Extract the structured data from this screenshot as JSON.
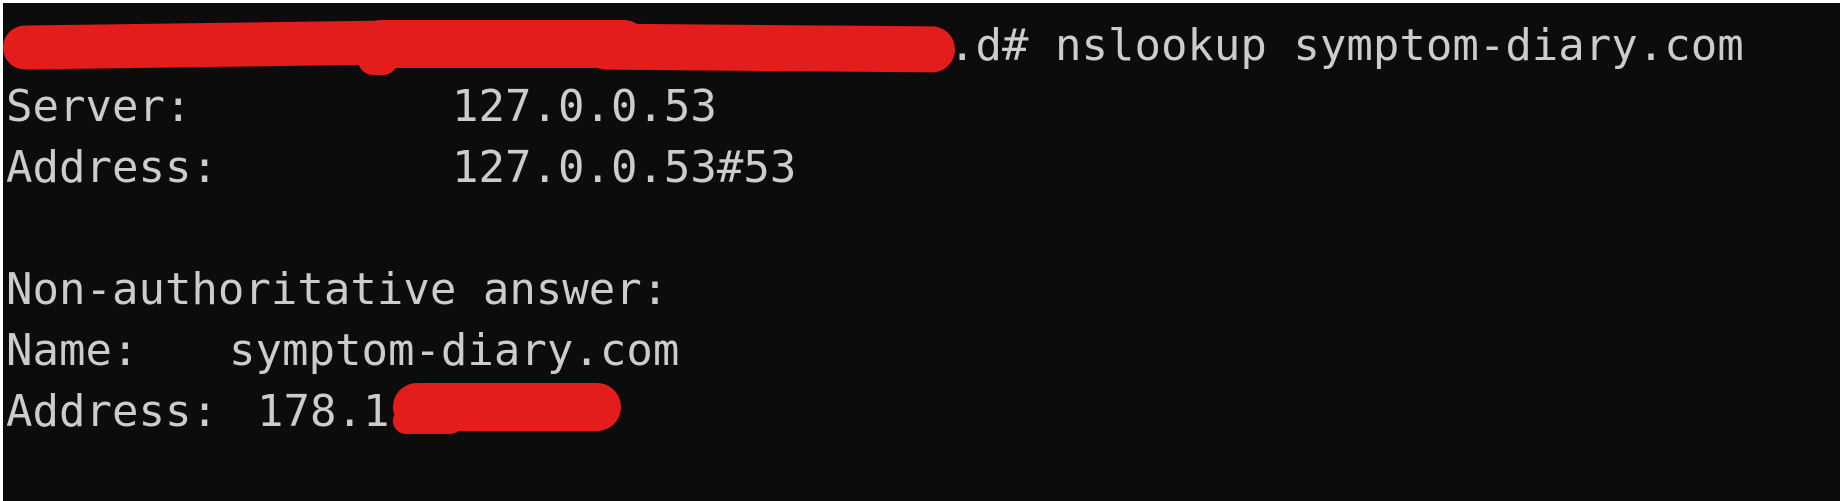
{
  "terminal": {
    "prompt": {
      "suffix": ".d#",
      "command": "nslookup symptom-diary.com"
    },
    "server": {
      "label": "Server:",
      "value": "127.0.0.53"
    },
    "server_address": {
      "label": "Address:",
      "value": "127.0.0.53#53"
    },
    "answer_header": "Non-authoritative answer:",
    "name": {
      "label": "Name:",
      "value": "symptom-diary.com"
    },
    "answer_address": {
      "label": "Address:",
      "value": "178.1"
    },
    "colors": {
      "background": "#0c0c0c",
      "foreground": "#cccccc",
      "redaction": "#e31c1c"
    }
  }
}
